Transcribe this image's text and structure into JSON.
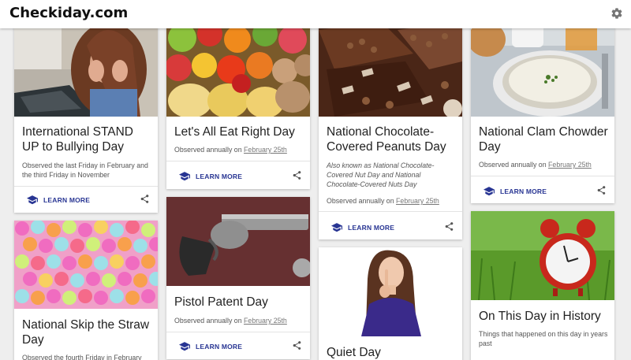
{
  "site": {
    "title": "Checkiday.com",
    "settings_icon": "gear-icon"
  },
  "learn_more_label": "LEARN MORE",
  "observed_prefix": "Observed annually on",
  "cards": {
    "bullying": {
      "title": "International STAND UP to Bullying Day",
      "description": "Observed the last Friday in February and the third Friday in November"
    },
    "eatright": {
      "title": "Let's All Eat Right Day",
      "date": "February 25th"
    },
    "pistol": {
      "title": "Pistol Patent Day",
      "date": "February 25th"
    },
    "chocolate": {
      "title": "National Chocolate-Covered Peanuts Day",
      "aka": "Also known as National Chocolate-Covered Nut Day and National Chocolate-Covered Nuts Day",
      "date": "February 25th"
    },
    "quiet": {
      "title": "Quiet Day"
    },
    "clam": {
      "title": "National Clam Chowder Day",
      "date": "February 25th"
    },
    "history": {
      "title": "On This Day in History",
      "description": "Things that happened on this day in years past"
    },
    "straw": {
      "title": "National Skip the Straw Day",
      "description": "Observed the fourth Friday in February"
    }
  },
  "colors": {
    "accent": "#283593",
    "background": "#eeeeee"
  }
}
